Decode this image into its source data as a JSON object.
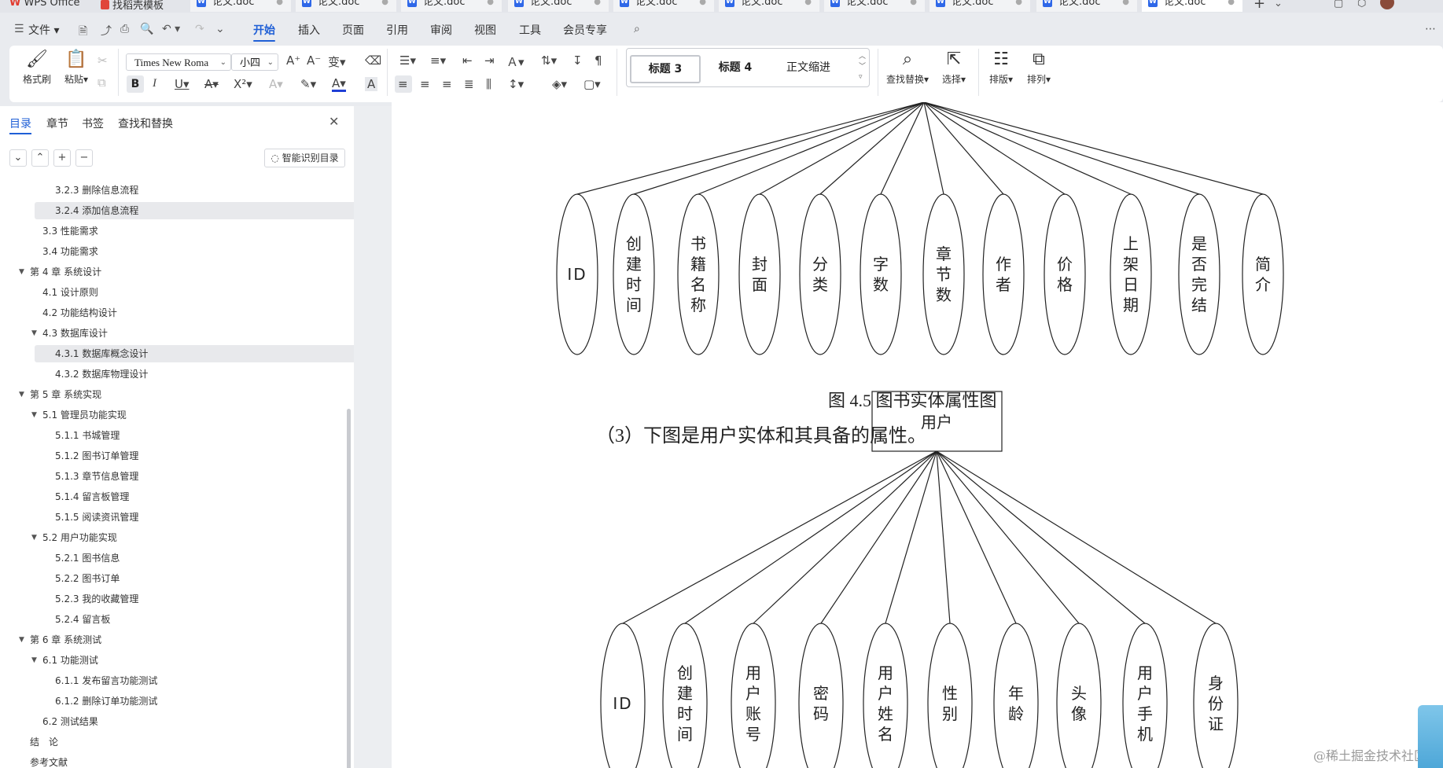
{
  "tabbar": {
    "home_label": "WPS Office",
    "template_label": "找稻壳模板",
    "doc_tabs": [
      "论文.doc",
      "论文.doc",
      "论文.doc",
      "论文.doc",
      "论文.doc",
      "论文.doc",
      "论文.doc",
      "论文.doc",
      "论文.doc",
      "论文.doc"
    ],
    "new_tab": "+"
  },
  "menubar": {
    "file": "文件",
    "items": [
      "开始",
      "插入",
      "页面",
      "引用",
      "审阅",
      "视图",
      "工具",
      "会员专享"
    ],
    "active": "开始"
  },
  "ribbon": {
    "format_painter": "格式刷",
    "paste": "粘贴",
    "font_name": "Times New Roma",
    "font_size": "小四",
    "styles": [
      "标题 3",
      "标题 4",
      "正文缩进"
    ],
    "find_replace": "查找替换",
    "select": "选择",
    "layout": "排版",
    "arrange": "排列"
  },
  "navpane": {
    "tabs": [
      "目录",
      "章节",
      "书签",
      "查找和替换"
    ],
    "smart_toc": "智能识别目录",
    "toc": [
      {
        "level": 3,
        "num": "3.2.3",
        "text": "删除信息流程"
      },
      {
        "level": 3,
        "num": "3.2.4",
        "text": "添加信息流程",
        "highlight": true
      },
      {
        "level": 2,
        "num": "3.3",
        "text": "性能需求"
      },
      {
        "level": 2,
        "num": "3.4",
        "text": "功能需求"
      },
      {
        "level": 1,
        "num": "第 4 章",
        "text": "系统设计",
        "expanded": true
      },
      {
        "level": 2,
        "num": "4.1",
        "text": "设计原则"
      },
      {
        "level": 2,
        "num": "4.2",
        "text": "功能结构设计"
      },
      {
        "level": 2,
        "num": "4.3",
        "text": "数据库设计",
        "expanded": true
      },
      {
        "level": 3,
        "num": "4.3.1",
        "text": "数据库概念设计",
        "highlight": true
      },
      {
        "level": 3,
        "num": "4.3.2",
        "text": "数据库物理设计"
      },
      {
        "level": 1,
        "num": "第 5 章",
        "text": "系统实现",
        "expanded": true
      },
      {
        "level": 2,
        "num": "5.1",
        "text": "管理员功能实现",
        "expanded": true
      },
      {
        "level": 3,
        "num": "5.1.1",
        "text": "书城管理"
      },
      {
        "level": 3,
        "num": "5.1.2",
        "text": "图书订单管理"
      },
      {
        "level": 3,
        "num": "5.1.3",
        "text": "章节信息管理"
      },
      {
        "level": 3,
        "num": "5.1.4",
        "text": "留言板管理"
      },
      {
        "level": 3,
        "num": "5.1.5",
        "text": "阅读资讯管理"
      },
      {
        "level": 2,
        "num": "5.2",
        "text": "用户功能实现",
        "expanded": true
      },
      {
        "level": 3,
        "num": "5.2.1",
        "text": "图书信息"
      },
      {
        "level": 3,
        "num": "5.2.2",
        "text": "图书订单"
      },
      {
        "level": 3,
        "num": "5.2.3",
        "text": "我的收藏管理"
      },
      {
        "level": 3,
        "num": "5.2.4",
        "text": "留言板"
      },
      {
        "level": 1,
        "num": "第 6 章",
        "text": "系统测试",
        "expanded": true
      },
      {
        "level": 2,
        "num": "6.1",
        "text": "功能测试",
        "expanded": true
      },
      {
        "level": 3,
        "num": "6.1.1",
        "text": "发布留言功能测试"
      },
      {
        "level": 3,
        "num": "6.1.2",
        "text": "删除订单功能测试"
      },
      {
        "level": 2,
        "num": "6.2",
        "text": "测试结果"
      },
      {
        "level": 1,
        "num": "",
        "text": "结　论"
      },
      {
        "level": 1,
        "num": "",
        "text": "参考文献"
      }
    ]
  },
  "document": {
    "book_attributes": [
      "ID",
      "创建时间",
      "书籍名称",
      "封面",
      "分类",
      "字数",
      "章节数",
      "作者",
      "价格",
      "上架日期",
      "是否完结",
      "简介"
    ],
    "caption": "图 4.5  图书实体属性图",
    "paragraph": "（3）下图是用户实体和其具备的属性。",
    "user_entity": "用户",
    "user_attributes": [
      "ID",
      "创建时间",
      "用户账号",
      "密码",
      "用户姓名",
      "性别",
      "年龄",
      "头像",
      "用户手机",
      "身份证"
    ]
  },
  "watermark": "@稀土掘金技术社区",
  "colors": {
    "accent": "#1f5fd6",
    "wps_red": "#e23b2f",
    "doc_icon": "#2f68e8"
  }
}
